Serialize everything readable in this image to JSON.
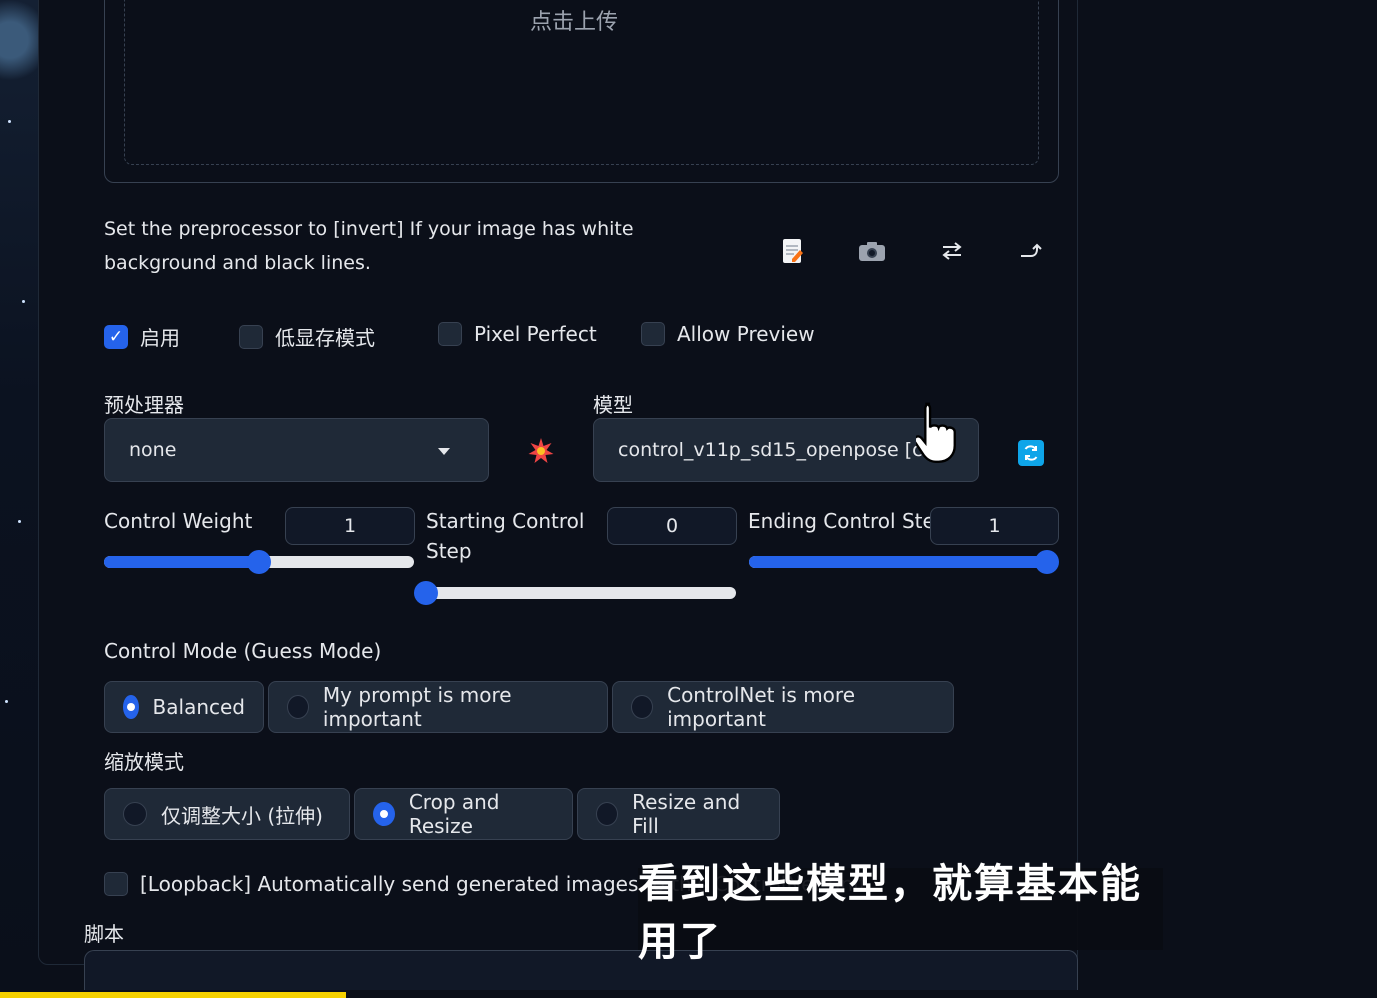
{
  "upload": {
    "text": "点击上传"
  },
  "hint": "Set the preprocessor to [invert] If your image has white background and black lines.",
  "tools": [
    "edit-icon",
    "camera-icon",
    "swap-icon",
    "send-up-icon"
  ],
  "checkboxes": [
    {
      "label": "启用",
      "checked": true
    },
    {
      "label": "低显存模式",
      "checked": false
    },
    {
      "label": "Pixel Perfect",
      "checked": false
    },
    {
      "label": "Allow Preview",
      "checked": false
    }
  ],
  "preprocessor": {
    "label": "预处理器",
    "value": "none"
  },
  "model": {
    "label": "模型",
    "value": "control_v11p_sd15_openpose [c"
  },
  "control_weight": {
    "label": "Control Weight",
    "value": "1",
    "level": 0.5
  },
  "starting_step": {
    "label_line1": "Starting Control",
    "label_line2": "Step",
    "value": "0",
    "level": 0
  },
  "ending_step": {
    "label": "Ending Control Step",
    "value": "1",
    "level": 1
  },
  "control_mode": {
    "label": "Control Mode (Guess Mode)",
    "options": [
      "Balanced",
      "My prompt is more important",
      "ControlNet is more important"
    ],
    "selected": "Balanced"
  },
  "resize_mode": {
    "label": "缩放模式",
    "options": [
      "仅调整大小 (拉伸)",
      "Crop and Resize",
      "Resize and Fill"
    ],
    "selected": "Crop and Resize"
  },
  "loopback": {
    "label": "[Loopback] Automatically send generated images to this ControlNet unit",
    "checked": false
  },
  "script": {
    "label": "脚本"
  },
  "subtitle": "看到这些模型，就算基本能用了",
  "colors": {
    "accent": "#2563eb",
    "background": "#0b0f19",
    "input_bg": "#1f2937"
  }
}
